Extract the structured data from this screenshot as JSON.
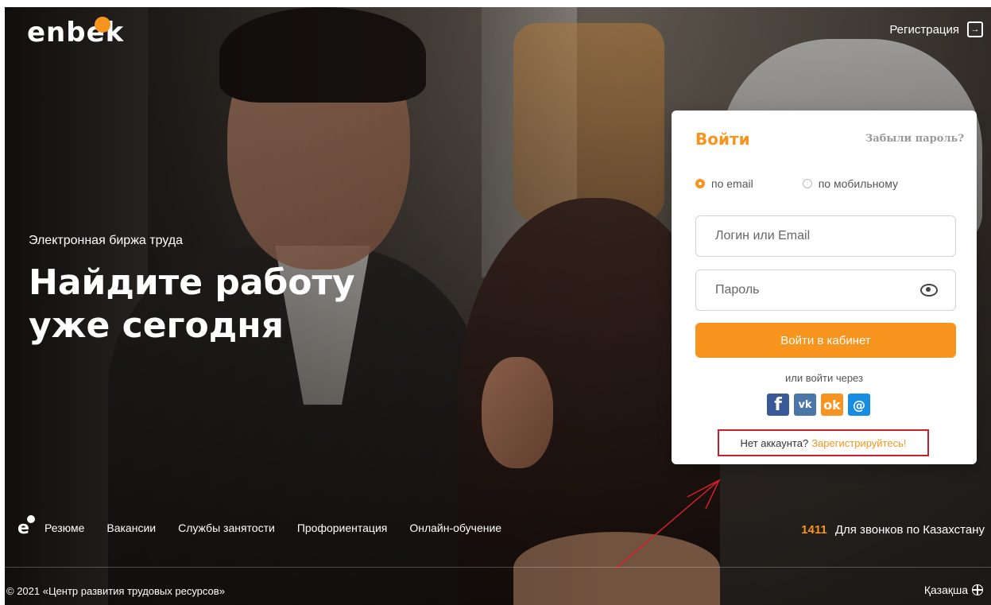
{
  "header": {
    "logo_text": "enbek",
    "register_label": "Регистрация"
  },
  "hero": {
    "subtitle": "Электронная биржа труда",
    "title": "Найдите работу уже сегодня"
  },
  "login": {
    "title": "Войти",
    "forgot_label": "Забыли пароль?",
    "radio_email": "по email",
    "radio_mobile": "по мобильному",
    "selected_method": "email",
    "login_placeholder": "Логин или Email",
    "password_placeholder": "Пароль",
    "submit_label": "Войти в кабинет",
    "or_via": "или войти через",
    "social": {
      "facebook": "f",
      "vk": "vk",
      "ok": "ok",
      "mail": "@"
    },
    "no_account_text": "Нет аккаунта?",
    "register_link": "Зарегистрируйтесь!"
  },
  "footer": {
    "logo_text": "e",
    "nav": [
      "Резюме",
      "Вакансии",
      "Службы занятости",
      "Профориентация",
      "Онлайн-обучение"
    ],
    "call_number": "1411",
    "call_text": "Для звонков по Казахстану",
    "copyright": "© 2021 «Центр развития трудовых ресурсов»",
    "language": "Қазақша"
  },
  "colors": {
    "accent": "#f7941d",
    "highlight_border": "#c81e28",
    "annotation_arrow": "#d0202c"
  }
}
